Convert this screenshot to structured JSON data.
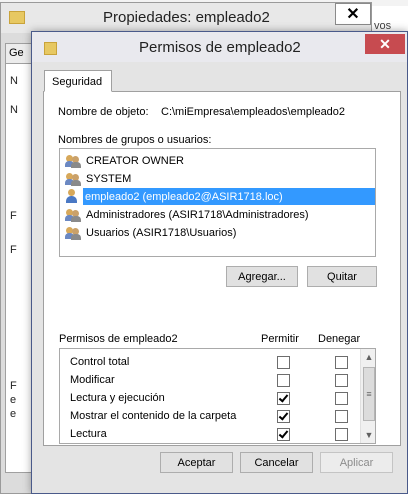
{
  "background_window": {
    "title": "Propiedades: empleado2",
    "close_glyph": "✕",
    "tab_label": "Ge",
    "side_letters": [
      "N",
      "N",
      "F",
      "F",
      "F",
      "e",
      "e"
    ],
    "top_strip_text": "",
    "right_edge_text": "vos"
  },
  "dialog": {
    "title": "Permisos de empleado2",
    "close_glyph": "✕",
    "tab_label": "Seguridad",
    "object_name_label": "Nombre de objeto:",
    "object_name_value": "C:\\miEmpresa\\empleados\\empleado2",
    "groups_label": "Nombres de grupos o usuarios:",
    "groups": [
      {
        "label": "CREATOR OWNER",
        "icon": "group-icon",
        "selected": false
      },
      {
        "label": "SYSTEM",
        "icon": "group-icon",
        "selected": false
      },
      {
        "label": "empleado2 (empleado2@ASIR1718.loc)",
        "icon": "user-icon",
        "selected": true
      },
      {
        "label": "Administradores (ASIR1718\\Administradores)",
        "icon": "group-icon",
        "selected": false
      },
      {
        "label": "Usuarios (ASIR1718\\Usuarios)",
        "icon": "group-icon",
        "selected": false
      }
    ],
    "add_button": "Agregar...",
    "remove_button": "Quitar",
    "permissions_label": "Permisos de empleado2",
    "allow_header": "Permitir",
    "deny_header": "Denegar",
    "permissions": [
      {
        "name": "Control total",
        "allow": false,
        "deny": false
      },
      {
        "name": "Modificar",
        "allow": false,
        "deny": false
      },
      {
        "name": "Lectura y ejecución",
        "allow": true,
        "deny": false
      },
      {
        "name": "Mostrar el contenido de la carpeta",
        "allow": true,
        "deny": false
      },
      {
        "name": "Lectura",
        "allow": true,
        "deny": false
      },
      {
        "name": "",
        "allow": false,
        "deny": false
      }
    ],
    "scroll_up_glyph": "▲",
    "scroll_down_glyph": "▼",
    "scroll_grip_glyph": "≡",
    "ok_button": "Aceptar",
    "cancel_button": "Cancelar",
    "apply_button": "Aplicar"
  },
  "colors": {
    "selection": "#3399ff",
    "close_button": "#c74b50",
    "folder": "#e7c862"
  }
}
